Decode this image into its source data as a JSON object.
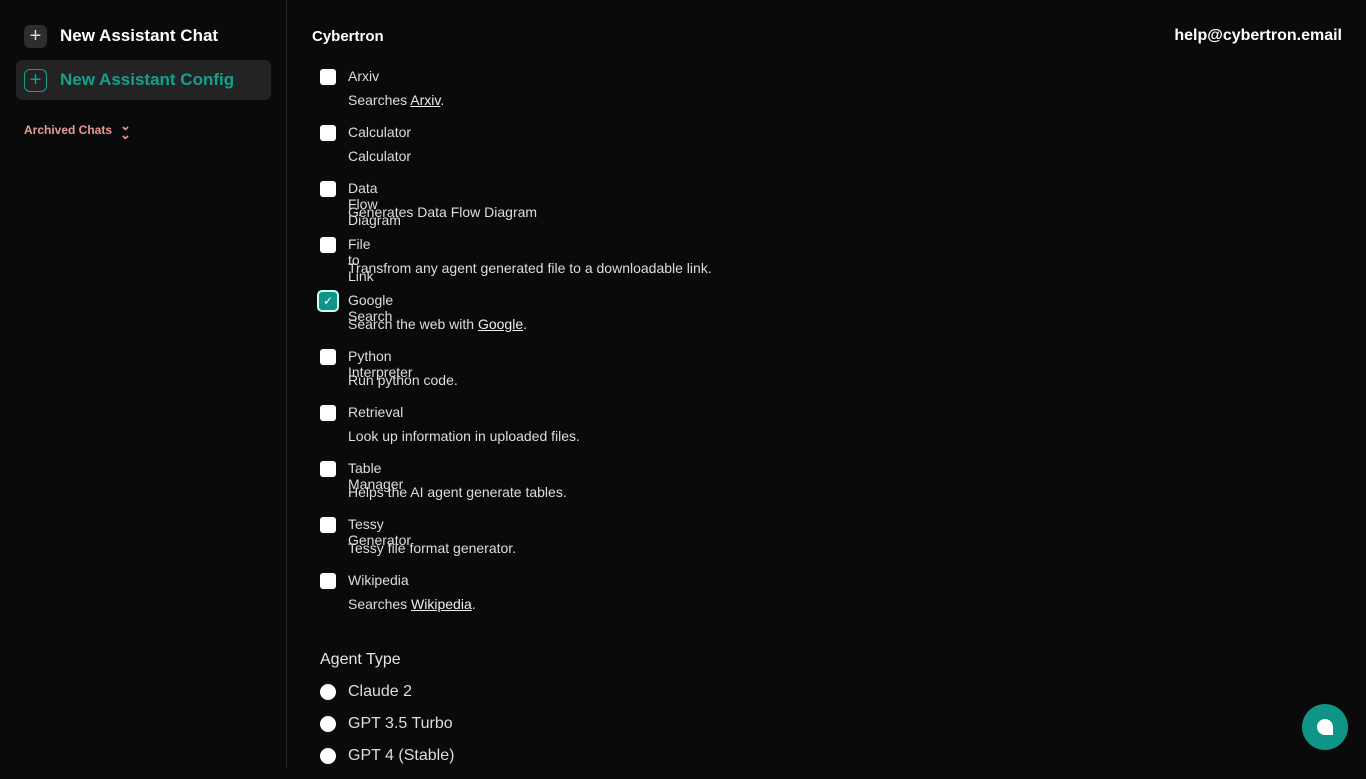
{
  "sidebar": {
    "new_chat": "New Assistant Chat",
    "new_config": "New Assistant Config",
    "archived": "Archived Chats"
  },
  "header": {
    "brand": "Cybertron",
    "email": "help@cybertron.email"
  },
  "tools": [
    {
      "name": "Arxiv",
      "pre": "Searches ",
      "link": "Arxiv",
      "post": ".",
      "checked": false
    },
    {
      "name": "Calculator",
      "pre": "Calculator",
      "link": "",
      "post": "",
      "checked": false
    },
    {
      "name": "Data Flow Diagram",
      "pre": "Generates Data Flow Diagram",
      "link": "",
      "post": "",
      "checked": false
    },
    {
      "name": "File to Link",
      "pre": "Transfrom any agent generated file to a downloadable link.",
      "link": "",
      "post": "",
      "checked": false
    },
    {
      "name": "Google Search",
      "pre": "Search the web with ",
      "link": "Google",
      "post": ".",
      "checked": true
    },
    {
      "name": "Python Interpreter",
      "pre": "Run python code.",
      "link": "",
      "post": "",
      "checked": false
    },
    {
      "name": "Retrieval",
      "pre": "Look up information in uploaded files.",
      "link": "",
      "post": "",
      "checked": false
    },
    {
      "name": "Table Manager",
      "pre": "Helps the AI agent generate tables.",
      "link": "",
      "post": "",
      "checked": false
    },
    {
      "name": "Tessy Generator",
      "pre": "Tessy file format generator.",
      "link": "",
      "post": "",
      "checked": false
    },
    {
      "name": "Wikipedia",
      "pre": "Searches ",
      "link": "Wikipedia",
      "post": ".",
      "checked": false
    }
  ],
  "agent_type": {
    "title": "Agent Type",
    "options": [
      "Claude 2",
      "GPT 3.5 Turbo",
      "GPT 4 (Stable)"
    ]
  },
  "colors": {
    "accent": "#0f9488",
    "archived": "#e89a9a"
  }
}
